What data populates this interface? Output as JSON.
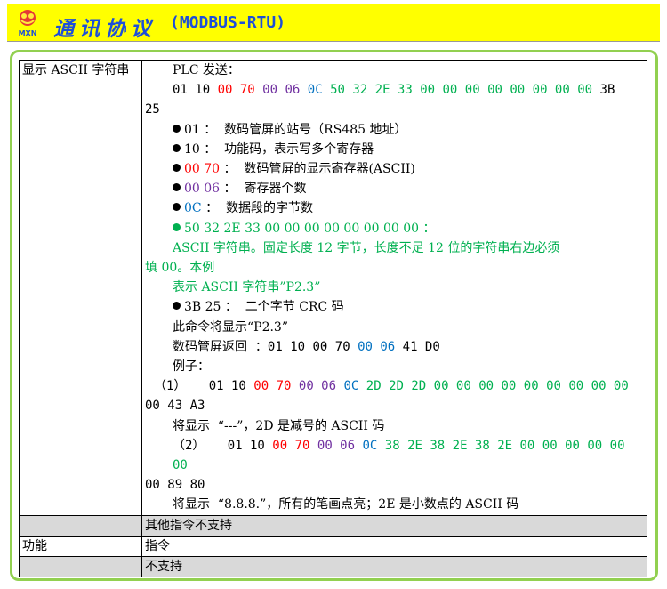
{
  "header": {
    "logo_text": "MXN",
    "title_cn": "通讯协议",
    "title_en": "(MODBUS-RTU)"
  },
  "rows": {
    "ascii_label": "显示 ASCII 字符串",
    "plc_send": "PLC 发送：",
    "frame": {
      "p1": "01 10 ",
      "reg": "00 70",
      "cnt": "00 06",
      "len": "0C",
      "data": "50 32 2E 33 00 00 00 00 00 00 00 00",
      "crc": "3B",
      "crc2": "25"
    },
    "bullets": {
      "b1": "01 ：  数码管屏的站号（RS485 地址）",
      "b2": "10 ：  功能码，表示写多个寄存器",
      "b3_code": "00 70",
      "b3_text": " ：  数码管屏的显示寄存器(ASCII)",
      "b4_code": "00 06",
      "b4_text": " ：  寄存器个数",
      "b5_code": "0C",
      "b5_text": " ：  数据段的字节数",
      "b6": "50 32 2E 33 00 00 00 00 00 00 00 00 ：",
      "g1": "ASCII 字符串。固定长度 12 字节，长度不足 12 位的字符串右边必须",
      "g2": "填 00。本例",
      "g3": "表示 ASCII 字符串”P2.3”",
      "b7": "3B 25 ：  二个字节 CRC 码"
    },
    "cmd_show": "此命令将显示“P2.3”",
    "reply_label": "数码管屏返回  ：",
    "reply_p1": "01 10 00 70 ",
    "reply_cnt": "00 06",
    "reply_end": " 41 D0",
    "example": "例子：",
    "ex1": {
      "num": "（1）   ",
      "p1": "01 10 ",
      "reg": "00 70",
      "cnt": "00 06",
      "len": "0C",
      "data": "2D 2D 2D 00 00 00 00 00 00 00 00 00",
      "cont": "00 43 A3",
      "note": "将显示  “---”，2D 是减号的 ASCII 码"
    },
    "ex2": {
      "num": "（2）   ",
      "p1": "01 10 ",
      "reg": "00 70",
      "cnt": "00 06",
      "len": "0C",
      "data": "38 2E 38 2E 38 2E 00 00 00 00 00 00",
      "cont": "00 89 80",
      "note": "将显示  “8.8.8.”，所有的笔画点亮；2E 是小数点的 ASCII 码"
    },
    "other_cmds": "其他指令不支持",
    "func_label": "功能",
    "cmd_label": "指令",
    "unsupported": "不支持"
  }
}
